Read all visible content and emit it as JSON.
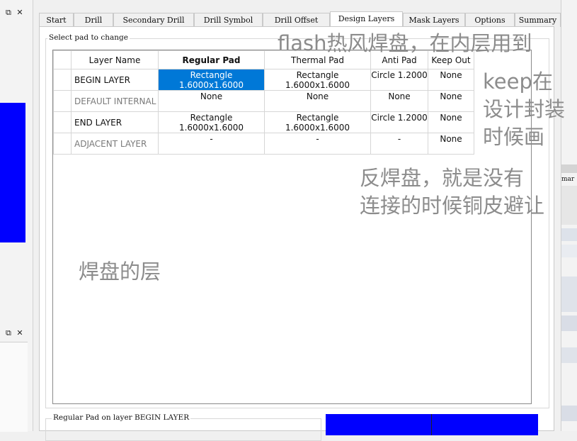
{
  "left_panel": {
    "dock_controls_top": "⧉ ✕",
    "dock_controls_bottom": "⧉ ✕"
  },
  "tabs": [
    "Start",
    "Drill",
    "Secondary Drill",
    "Drill Symbol",
    "Drill Offset",
    "Design Layers",
    "Mask Layers",
    "Options",
    "Summary"
  ],
  "active_tab": "Design Layers",
  "group_label": "Select pad to change",
  "table": {
    "headers": [
      "Layer Name",
      "Regular Pad",
      "Thermal Pad",
      "Anti Pad",
      "Keep Out"
    ],
    "rows": [
      {
        "layer": "BEGIN LAYER",
        "regular": "Rectangle 1.6000x1.6000",
        "thermal": "Rectangle 1.6000x1.6000",
        "anti": "Circle 1.2000",
        "keepout": "None"
      },
      {
        "layer": "DEFAULT INTERNAL",
        "regular": "None",
        "thermal": "None",
        "anti": "None",
        "keepout": "None"
      },
      {
        "layer": "END LAYER",
        "regular": "Rectangle 1.6000x1.6000",
        "thermal": "Rectangle 1.6000x1.6000",
        "anti": "Circle 1.2000",
        "keepout": "None"
      },
      {
        "layer": "ADJACENT LAYER",
        "regular": "-",
        "thermal": "-",
        "anti": "-",
        "keepout": "None"
      }
    ]
  },
  "bottom_label": "Regular Pad on layer BEGIN LAYER",
  "right_panel": {
    "partial_text": "mar"
  },
  "annotations": {
    "flash": "flash热风焊盘，在内层用到",
    "keep_line1": "keep在",
    "keep_line2": "设计封装",
    "keep_line3": "时候画",
    "anti_line1": "反焊盘，就是没有",
    "anti_line2": "连接的时候铜皮避让",
    "layer": "焊盘的层"
  },
  "colors": {
    "selection": "#0078d7",
    "blue_panel": "#0000ff",
    "annotation": "#8c8c8c"
  }
}
